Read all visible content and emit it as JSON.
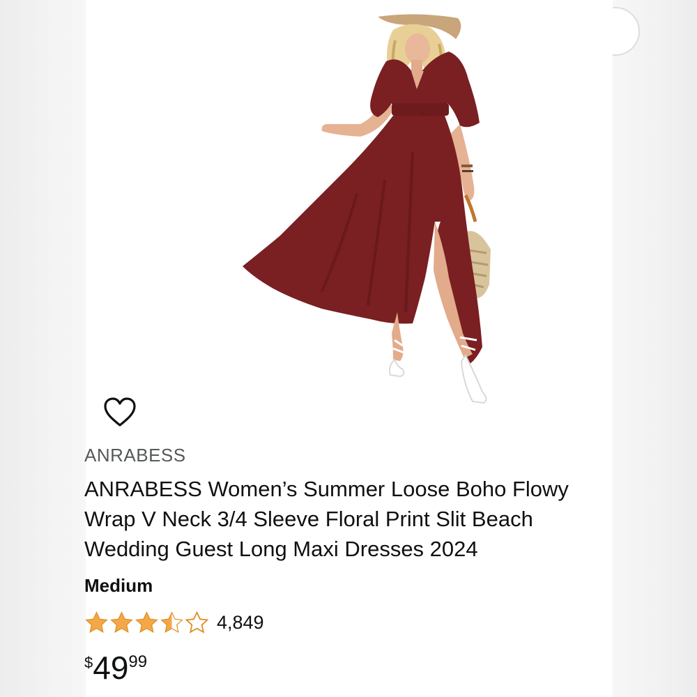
{
  "product": {
    "brand": "ANRABESS",
    "title_lines": [
      "ANRABESS Women’s Summer Loose Boho Flowy",
      "Wrap V Neck 3/4 Sleeve Floral Print Slit Beach",
      "Wedding Guest Long Maxi Dresses 2024"
    ],
    "size": "Medium",
    "rating": {
      "stars": 3.5,
      "out_of": 5,
      "count": "4,849"
    },
    "price": {
      "symbol": "$",
      "whole": "49",
      "fraction": "99"
    }
  },
  "icons": {
    "wishlist": "heart-icon",
    "star": "star-icon",
    "product_photo": "dress-photo"
  },
  "colors": {
    "star_fill": "#f3a847",
    "text_primary": "#0f1111",
    "text_secondary": "#565959",
    "dress": "#7a1f22"
  }
}
